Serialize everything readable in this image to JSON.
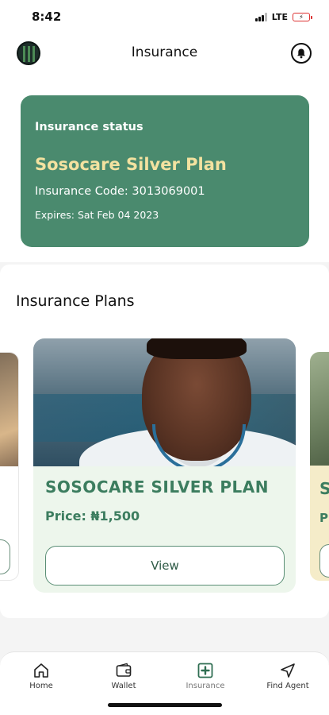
{
  "status_bar": {
    "time": "8:42",
    "network": "LTE"
  },
  "header": {
    "title": "Insurance"
  },
  "insurance_status": {
    "label": "Insurance status",
    "plan_name": "Sosocare Silver Plan",
    "code": "Insurance Code: 3013069001",
    "expires": "Expires: Sat Feb 04 2023"
  },
  "plans": {
    "title": "Insurance Plans",
    "cards": [
      {
        "name": "SOSOCARE SILVER PLAN",
        "price": "Price: ₦1,500",
        "button_label": "View"
      }
    ],
    "next_card_peek": {
      "name_initial": "S",
      "price_initial": "P"
    }
  },
  "bottom_nav": {
    "items": [
      {
        "label": "Home",
        "icon": "home-icon"
      },
      {
        "label": "Wallet",
        "icon": "wallet-icon"
      },
      {
        "label": "Insurance",
        "icon": "insurance-cross-icon",
        "active": true
      },
      {
        "label": "Find Agent",
        "icon": "location-arrow-icon"
      }
    ]
  },
  "colors": {
    "status_card_bg": "#4a8a6e",
    "plan_title_accent": "#f3e2a0",
    "plan_card_bg": "#edf6ec",
    "plan_text": "#3c7d5f"
  }
}
